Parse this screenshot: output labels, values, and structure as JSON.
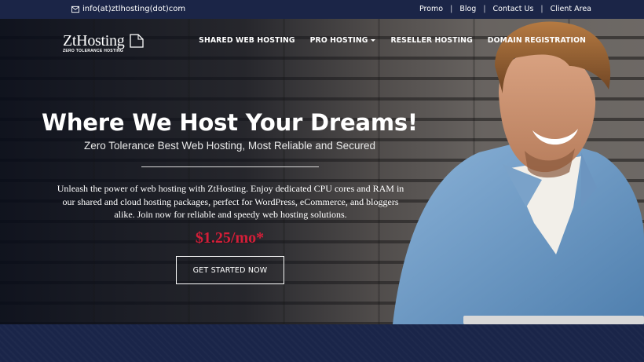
{
  "topbar": {
    "email": "info(at)ztlhosting(dot)com",
    "links": [
      "Promo",
      "Blog",
      "Contact Us",
      "Client Area"
    ]
  },
  "logo": {
    "brand": "ZtHosting",
    "tagline": "ZERO TOLERANCE HOSTING"
  },
  "nav": {
    "items": [
      "SHARED WEB HOSTING",
      "PRO HOSTING",
      "RESELLER HOSTING",
      "DOMAIN REGISTRATION"
    ]
  },
  "hero": {
    "title": "Where We Host Your Dreams!",
    "subtitle": "Zero Tolerance Best Web Hosting, Most Reliable and Secured",
    "description": "Unleash the power of web hosting with ZtHosting. Enjoy dedicated CPU cores and RAM in our shared and cloud hosting packages, perfect for WordPress, eCommerce, and bloggers alike. Join now for reliable and speedy web hosting solutions.",
    "price": "$1.25/mo*",
    "cta": "GET STARTED NOW"
  },
  "colors": {
    "topbar": "#1b2547",
    "price": "#d41e38",
    "bottom": "#1a2549"
  },
  "icons": {
    "email": "envelope-icon",
    "dropdown": "caret-down-icon",
    "logo": "server-page-icon"
  }
}
